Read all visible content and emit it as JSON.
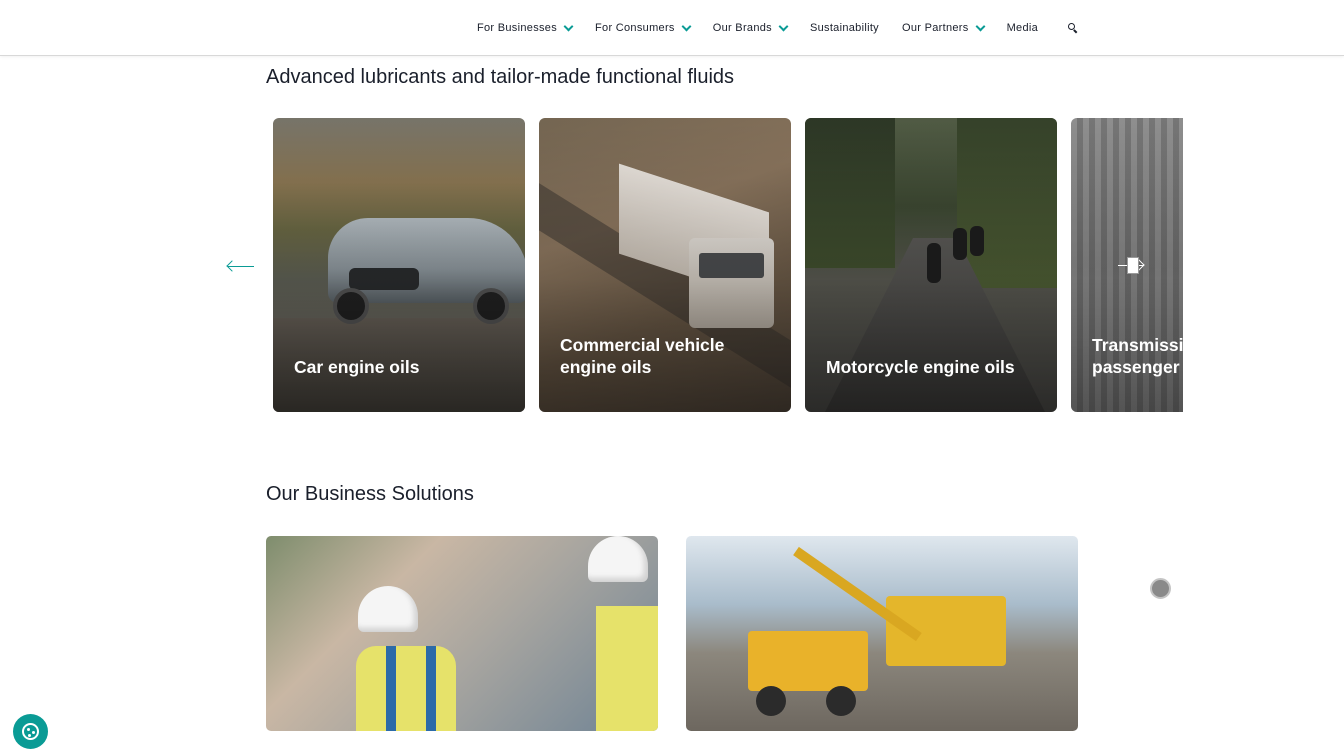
{
  "nav": {
    "items": [
      {
        "label": "For Businesses",
        "has_dropdown": true
      },
      {
        "label": "For Consumers",
        "has_dropdown": true
      },
      {
        "label": "Our Brands",
        "has_dropdown": true
      },
      {
        "label": "Sustainability",
        "has_dropdown": false
      },
      {
        "label": "Our Partners",
        "has_dropdown": true
      },
      {
        "label": "Media",
        "has_dropdown": false
      }
    ],
    "search_icon": "search-icon",
    "accent_color": "#0a9b95"
  },
  "lubricants": {
    "title": "Advanced lubricants and tailor-made functional fluids",
    "cards": [
      {
        "label": "Car engine oils"
      },
      {
        "label": "Commercial vehicle engine oils"
      },
      {
        "label": "Motorcycle engine oils"
      },
      {
        "label": "Transmission fluids for passenger cars"
      }
    ],
    "prev_icon": "arrow-left-icon",
    "next_icon": "arrow-right-icon"
  },
  "business": {
    "title": "Our Business Solutions"
  },
  "cookie": {
    "icon": "cookie-icon"
  }
}
